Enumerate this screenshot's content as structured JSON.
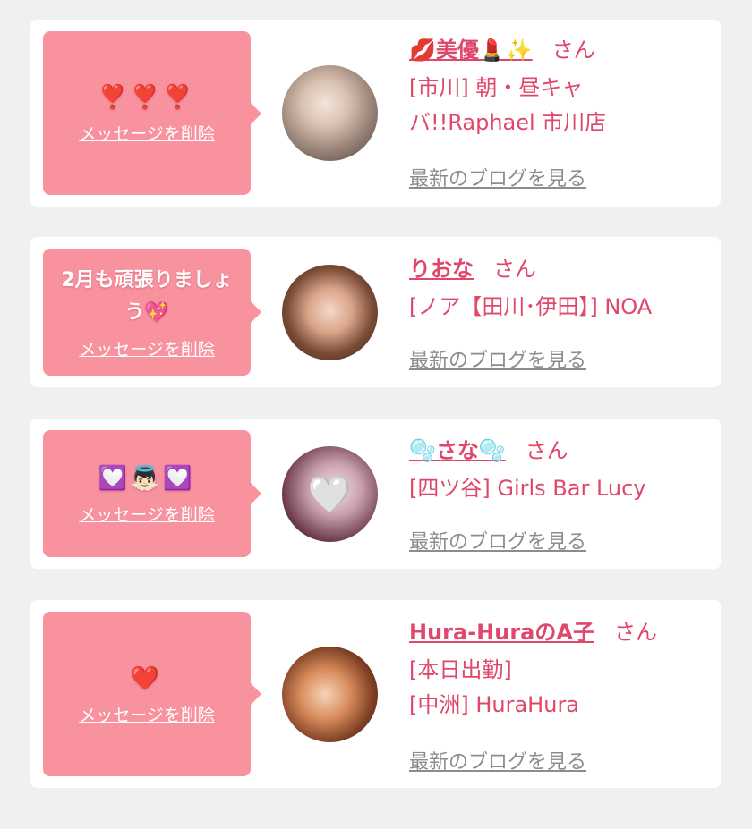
{
  "messages": [
    {
      "bubble_text": "❣️❣️❣️",
      "delete_label": "メッセージを削除",
      "name": "💋美優💄✨",
      "honorific": "さん",
      "shop_lines": [
        "[市川] 朝・昼キャ",
        "バ!!Raphael 市川店"
      ],
      "blog_label": "最新のブログを見る"
    },
    {
      "bubble_text": "2月も頑張りましょう💖",
      "delete_label": "メッセージを削除",
      "name": "りおな",
      "honorific": "さん",
      "shop_lines": [
        "[ノア【田川･伊田】] NOA"
      ],
      "blog_label": "最新のブログを見る"
    },
    {
      "bubble_text": "💟👼🏻💟",
      "delete_label": "メッセージを削除",
      "name": "🫧さな🫧",
      "honorific": "さん",
      "shop_lines": [
        "[四ツ谷] Girls Bar Lucy"
      ],
      "blog_label": "最新のブログを見る"
    },
    {
      "bubble_text": "❤️",
      "delete_label": "メッセージを削除",
      "name": "Hura-HuraのA子",
      "honorific": "さん",
      "shop_lines": [
        "[本日出勤]",
        "[中洲] HuraHura"
      ],
      "blog_label": "最新のブログを見る"
    }
  ],
  "avatar_overlay_icons": [
    "",
    "",
    "🤍",
    ""
  ],
  "colors": {
    "accent": "#e0476a",
    "bubble": "#f8929f",
    "muted_link": "#8c8c8c",
    "background": "#f0f0f0"
  }
}
